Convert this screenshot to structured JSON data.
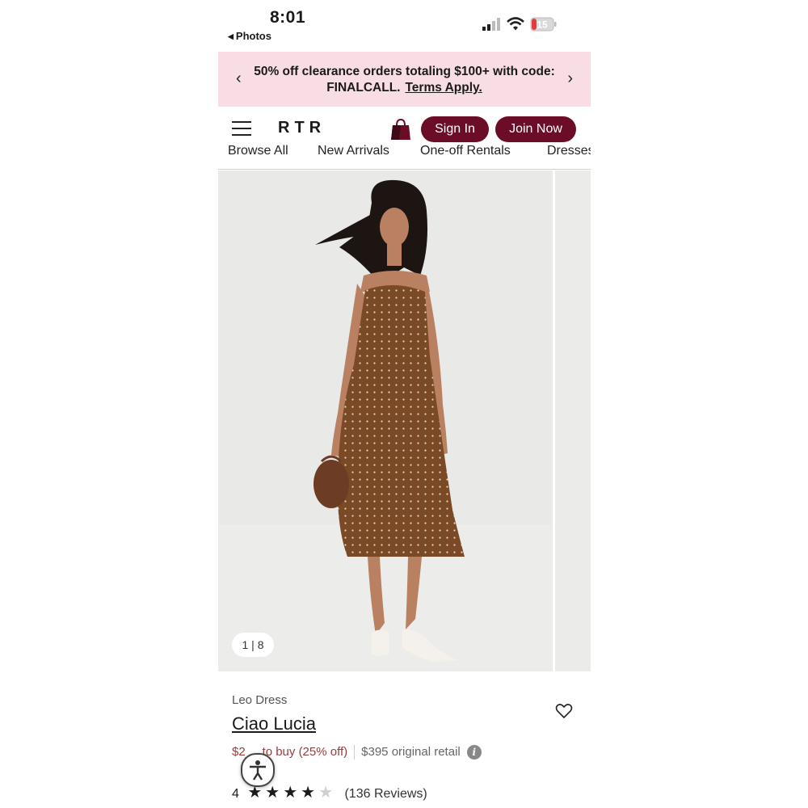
{
  "status_bar": {
    "time": "8:01",
    "back_app": "Photos",
    "battery": "15"
  },
  "promo": {
    "text": "50% off clearance orders totaling $100+ with code: FINALCALL.",
    "link": "Terms Apply."
  },
  "header": {
    "logo": "RTR",
    "sign_in": "Sign In",
    "join_now": "Join Now"
  },
  "nav": {
    "items": [
      "Browse All",
      "New Arrivals",
      "One-off Rentals",
      "Dresses"
    ]
  },
  "gallery": {
    "counter": "1 | 8"
  },
  "product": {
    "brand": "Leo Dress",
    "name": "Ciao Lucia",
    "price_buy": "$2__ to buy (25% off)",
    "price_original": "$395 original retail",
    "rating": "4",
    "reviews": "(136 Reviews)"
  },
  "colors": {
    "accent": "#6b0d27",
    "promo_bg": "#f8dde4",
    "dress": "#7a4a26"
  },
  "icons": [
    "hamburger-icon",
    "shopping-bag-icon",
    "heart-icon",
    "info-icon",
    "accessibility-icon",
    "chevron-left-icon",
    "chevron-right-icon"
  ]
}
